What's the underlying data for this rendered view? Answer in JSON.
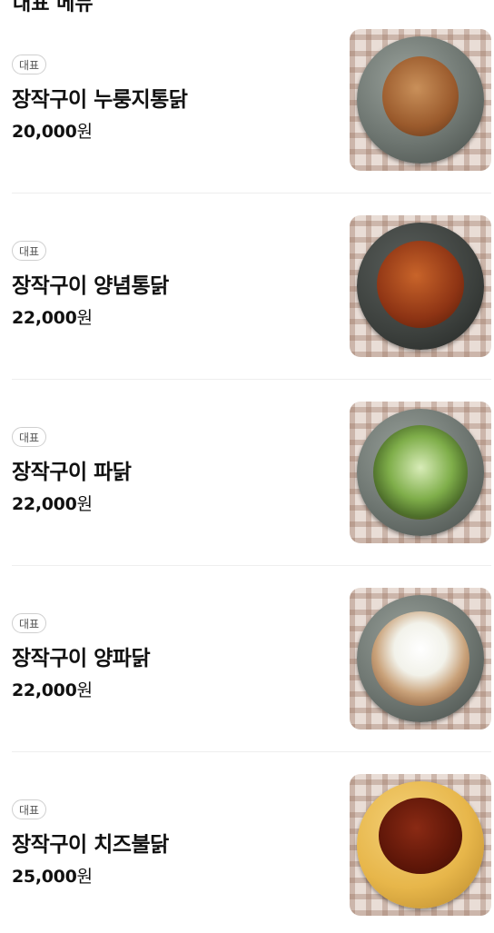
{
  "header": {
    "title": "대표 메뉴"
  },
  "menu": [
    {
      "badge": "대표",
      "name": "장작구이 누룽지통닭",
      "price": "20,000",
      "currency": "원",
      "photo": "roasted-chicken"
    },
    {
      "badge": "대표",
      "name": "장작구이 양념통닭",
      "price": "22,000",
      "currency": "원",
      "photo": "sauced-chicken"
    },
    {
      "badge": "대표",
      "name": "장작구이 파닭",
      "price": "22,000",
      "currency": "원",
      "photo": "scallion-chicken"
    },
    {
      "badge": "대표",
      "name": "장작구이 양파닭",
      "price": "22,000",
      "currency": "원",
      "photo": "onion-chicken"
    },
    {
      "badge": "대표",
      "name": "장작구이 치즈불닭",
      "price": "25,000",
      "currency": "원",
      "photo": "cheese-fire-chicken"
    }
  ]
}
